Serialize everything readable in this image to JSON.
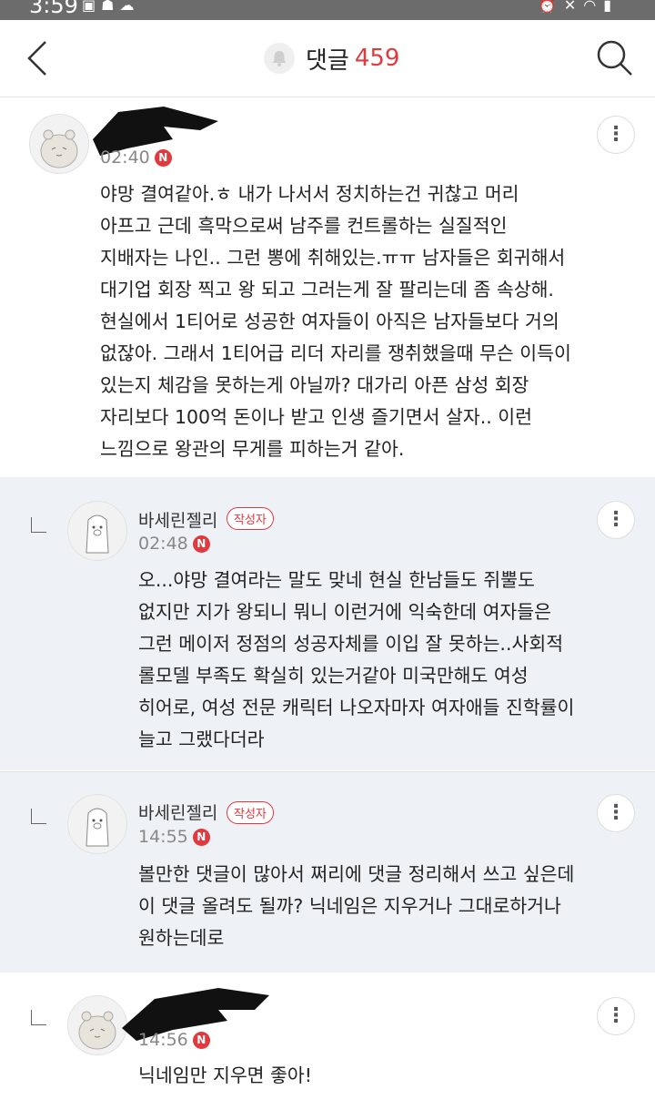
{
  "status_bar": {
    "time": "3:59",
    "left_icons": [
      "gallery-icon",
      "photo-icon",
      "cloud-icon"
    ],
    "right_icons": [
      "alarm-icon",
      "mute-icon",
      "wifi-icon",
      "signal-icon"
    ]
  },
  "header": {
    "title": "댓글",
    "count": "459",
    "count_color": "#e0393e"
  },
  "comments": [
    {
      "nickname": "",
      "time": "02:40",
      "new_badge": "N",
      "text": "야망 결여같아.ㅎ 내가 나서서 정치하는건 귀찮고 머리\n아프고 근데 흑막으로써 남주를 컨트롤하는 실질적인\n지배자는 나인.. 그런 뽕에 취해있는.ㅠㅠ 남자들은 회귀해서\n대기업 회장 찍고 왕 되고 그러는게 잘 팔리는데 좀 속상해.\n현실에서 1티어로 성공한 여자들이 아직은 남자들보다 거의\n없잖아. 그래서 1티어급 리더 자리를 쟁취했을때 무슨 이득이\n있는지 체감을 못하는게 아닐까? 대가리 아픈 삼성 회장\n자리보다 100억 돈이나 받고 인생 즐기면서 살자.. 이런\n느낌으로 왕관의 무게를 피하는거 같아."
    },
    {
      "nickname": "바세린젤리",
      "author_badge": "작성자",
      "time": "02:48",
      "new_badge": "N",
      "text": "오...야망 결여라는 말도 맞네 현실 한남들도 쥐뿔도\n없지만 지가 왕되니 뭐니 이런거에 익숙한데 여자들은\n그런 메이저 정점의 성공자체를 이입 잘 못하는..사회적\n롤모델 부족도 확실히 있는거같아 미국만해도 여성\n히어로, 여성 전문 캐릭터 나오자마자 여자애들 진학률이\n늘고 그랬다더라"
    },
    {
      "nickname": "바세린젤리",
      "author_badge": "작성자",
      "time": "14:55",
      "new_badge": "N",
      "text": "볼만한 댓글이 많아서 쩌리에 댓글 정리해서 쓰고 싶은데\n이 댓글 올려도 될까? 닉네임은 지우거나 그대로하거나\n원하는데로"
    },
    {
      "nickname": "",
      "time": "14:56",
      "new_badge": "N",
      "text": "닉네임만 지우면 좋아!"
    }
  ]
}
